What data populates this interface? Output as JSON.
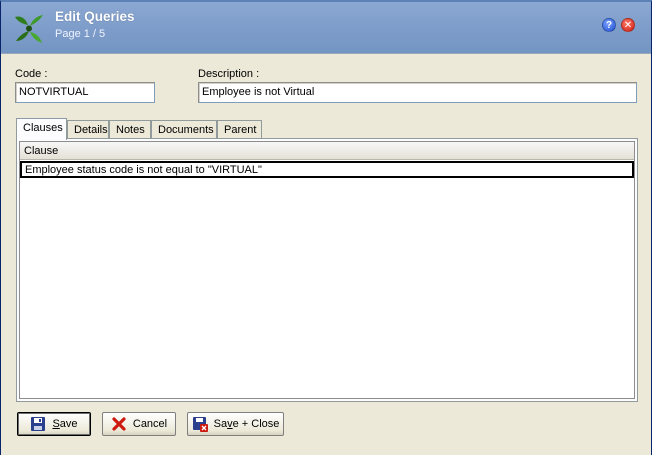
{
  "window": {
    "title": "Edit Queries",
    "subtitle": "Page 1 / 5",
    "help_icon": "help-icon",
    "close_icon": "close-icon"
  },
  "form": {
    "code_label": "Code :",
    "code_value": "NOTVIRTUAL",
    "description_label": "Description :",
    "description_value": "Employee is not Virtual"
  },
  "tabs": [
    {
      "label": "Clauses",
      "active": true
    },
    {
      "label": "Details",
      "active": false
    },
    {
      "label": "Notes",
      "active": false
    },
    {
      "label": "Documents",
      "active": false
    },
    {
      "label": "Parent",
      "active": false
    }
  ],
  "clauses_grid": {
    "columns": [
      "Clause"
    ],
    "rows": [
      [
        "Employee status code is not equal to \"VIRTUAL\""
      ]
    ]
  },
  "buttons": {
    "save": {
      "label_first": "S",
      "label_rest": "ave"
    },
    "cancel": {
      "label": "Cancel"
    },
    "save_close": {
      "label_first": "Sa",
      "label_mid": "v",
      "label_rest": "e + Close"
    }
  },
  "colors": {
    "title_bar": "#7d9bc8",
    "window_bg": "#ece9d8",
    "cancel_icon": "#cc1a10"
  }
}
